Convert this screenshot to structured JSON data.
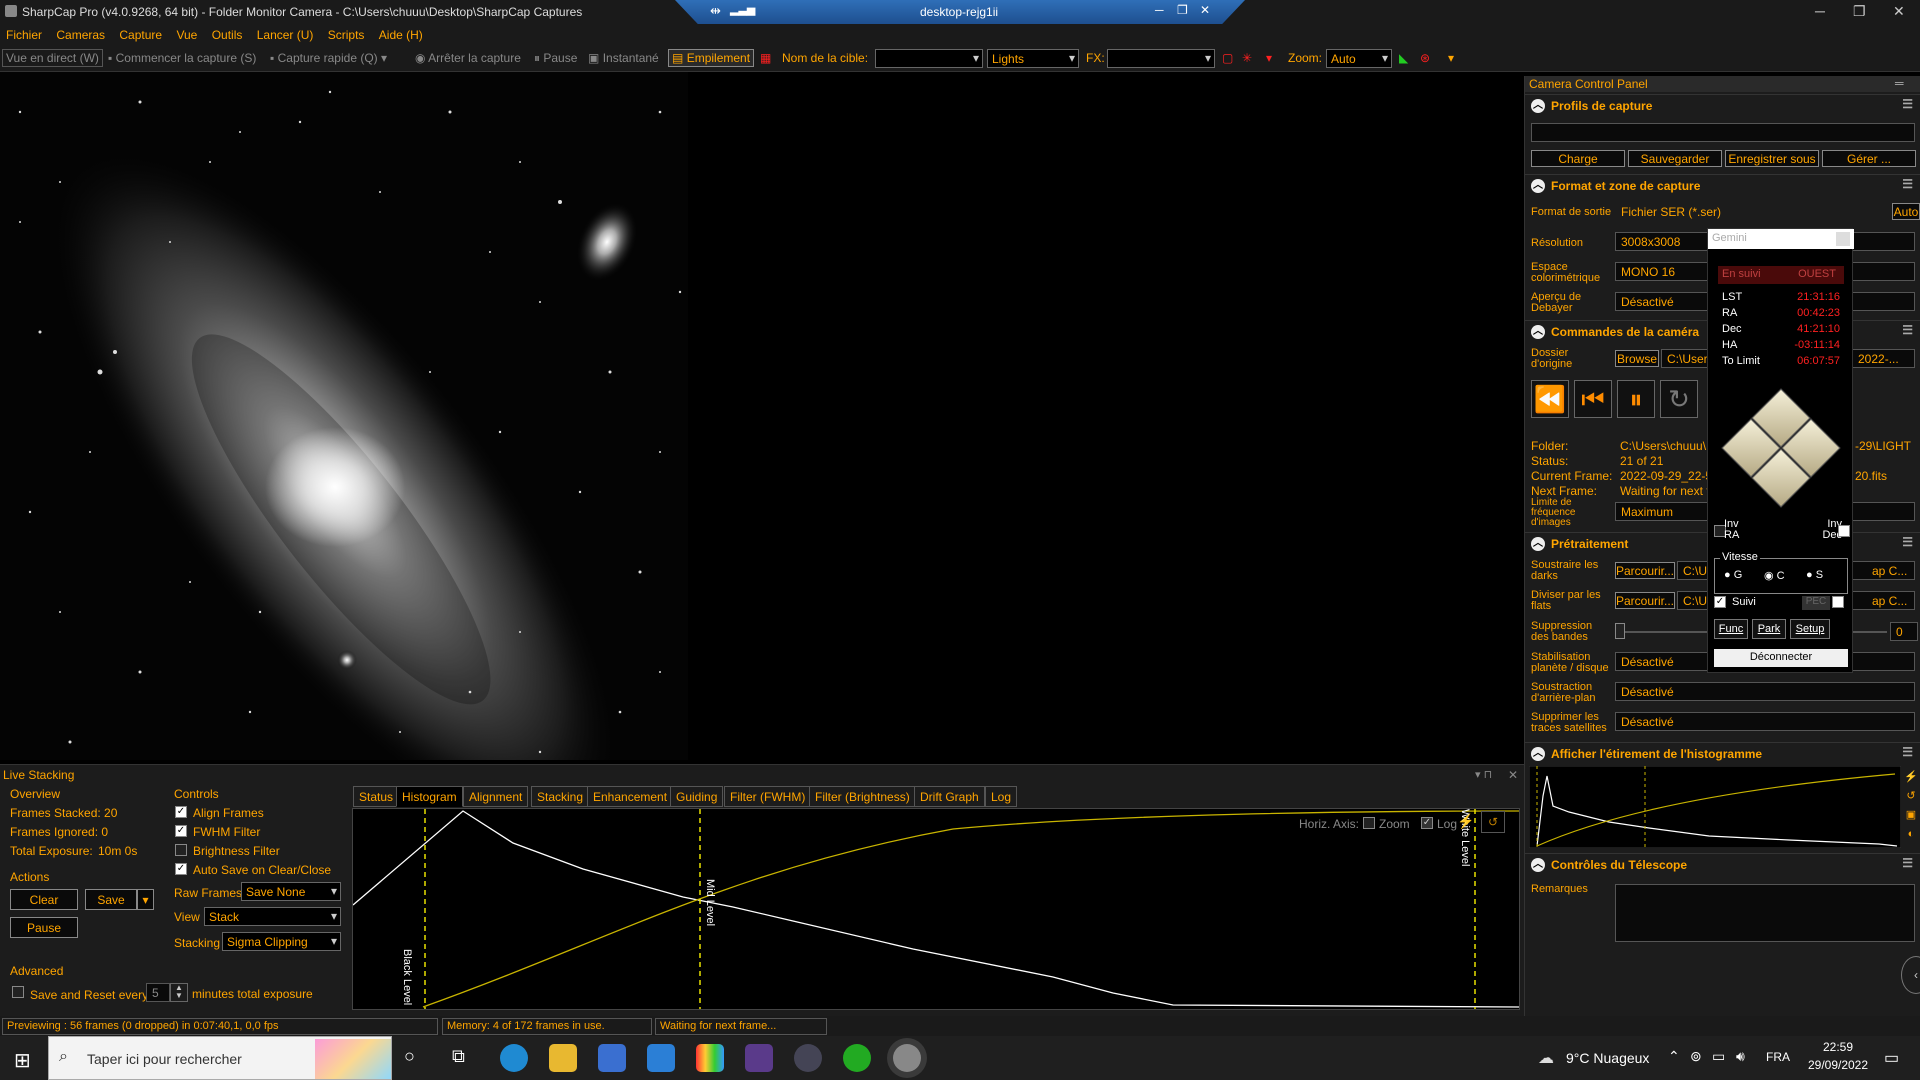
{
  "title_bar": {
    "title": "SharpCap Pro (v4.0.9268, 64 bit) - Folder Monitor Camera - C:\\Users\\chuuu\\Desktop\\SharpCap Captures",
    "remote": "desktop-rejg1ii"
  },
  "menu": [
    "Fichier",
    "Cameras",
    "Capture",
    "Vue",
    "Outils",
    "Lancer (U)",
    "Scripts",
    "Aide (H)"
  ],
  "toolbar": {
    "live_view": "Vue en direct (W)",
    "start_capture": "Commencer la capture (S)",
    "quick_capture": "Capture rapide (Q)",
    "stop_capture": "Arrêter la capture",
    "pause": "Pause",
    "snapshot": "Instantané",
    "stacking": "Empilement",
    "target_label": "Nom de la cible:",
    "target_value": "",
    "frame_type": "Lights",
    "fx_label": "FX:",
    "fx_value": "",
    "zoom_label": "Zoom:",
    "zoom_value": "Auto"
  },
  "camera_panel": {
    "title": "Camera Control Panel",
    "profiles": {
      "title": "Profils de capture",
      "value": "",
      "buttons": [
        "Charge",
        "Sauvegarder",
        "Enregistrer sous",
        "Gérer ..."
      ]
    },
    "format": {
      "title": "Format et zone de capture",
      "output_label": "Format de sortie",
      "output_value": "Fichier SER (*.ser)",
      "auto": "Auto",
      "res_label": "Résolution",
      "res_value": "3008x3008",
      "color_label": "Espace colorimétrique",
      "color_value": "MONO 16",
      "debayer_label": "Aperçu de Debayer",
      "debayer_value": "Désactivé"
    },
    "commands": {
      "title": "Commandes de la caméra",
      "origin_label": "Dossier d'origine",
      "browse": "Browse",
      "origin_value": "C:\\Users",
      "origin_tail": "2022-...",
      "folder_label": "Folder:",
      "folder_value": "C:\\Users\\chuuu\\",
      "folder_tail": "-29\\LIGHT",
      "status_label": "Status:",
      "status_value": "21 of 21",
      "current_label": "Current Frame:",
      "current_value": "2022-09-29_22-5",
      "current_tail": "20.fits",
      "next_label": "Next Frame:",
      "next_value": "Waiting for next f",
      "limit_label": "Limite de fréquence d'images",
      "limit_value": "Maximum"
    },
    "preprocessing": {
      "title": "Prétraitement",
      "darks_label": "Soustraire les darks",
      "darks_btn": "Parcourir...",
      "darks_value": "C:\\U",
      "darks_tail": "ap C...",
      "flats_label": "Diviser par les flats",
      "flats_btn": "Parcourir...",
      "flats_value": "C:\\U",
      "flats_tail": "ap C...",
      "banding_label": "Suppression des bandes",
      "banding_value": "0",
      "stab_label": "Stabilisation planète / disque",
      "stab_value": "Désactivé",
      "bg_label": "Soustraction d'arrière-plan",
      "bg_value": "Désactivé",
      "sat_label": "Supprimer les traces satellites",
      "sat_value": "Désactivé"
    },
    "histogram_title": "Afficher l'étirement de l'histogramme",
    "telescope": {
      "title": "Contrôles du Télescope",
      "remarks": "Remarques"
    }
  },
  "gemini": {
    "title": "Gemini",
    "tracking": "En suivi",
    "side": "OUEST",
    "rows": [
      {
        "k": "LST",
        "v": "21:31:16"
      },
      {
        "k": "RA",
        "v": "00:42:23"
      },
      {
        "k": "Dec",
        "v": "41:21:10"
      },
      {
        "k": "HA",
        "v": "-03:11:14"
      },
      {
        "k": "To Limit",
        "v": "06:07:57"
      }
    ],
    "inv_ra": "Inv RA",
    "inv_dec": "Inv Dec",
    "speed_label": "Vitesse",
    "speeds": [
      "G",
      "C",
      "S"
    ],
    "track": "Suivi",
    "pec": "PEC",
    "func": "Func",
    "park": "Park",
    "setup": "Setup",
    "disconnect": "Déconnecter"
  },
  "live_stacking": {
    "title": "Live Stacking",
    "overview": "Overview",
    "frames_stacked": "Frames Stacked: 20",
    "frames_ignored": "Frames Ignored: 0",
    "total_exposure_label": "Total Exposure:",
    "total_exposure_value": "10m 0s",
    "actions": "Actions",
    "clear": "Clear",
    "save": "Save",
    "pause": "Pause",
    "advanced": "Advanced",
    "save_reset": "Save and Reset every",
    "save_reset_value": "5",
    "save_reset_tail": "minutes total exposure",
    "controls": "Controls",
    "align": "Align Frames",
    "fwhm": "FWHM Filter",
    "brightness": "Brightness Filter",
    "autosave": "Auto Save on Clear/Close",
    "raw_label": "Raw Frames",
    "raw_value": "Save None",
    "view_label": "View",
    "view_value": "Stack",
    "stacking_label": "Stacking",
    "stacking_value": "Sigma Clipping",
    "tabs": [
      "Status",
      "Histogram",
      "Alignment",
      "Stacking",
      "Enhancement",
      "Guiding",
      "Filter (FWHM)",
      "Filter (Brightness)",
      "Drift Graph",
      "Log"
    ],
    "horiz_axis": "Horiz. Axis:",
    "zoom": "Zoom",
    "log": "Log",
    "black_level": "Black Level",
    "mid_level": "Mid Level",
    "white_level": "White Level"
  },
  "status": {
    "preview": "Previewing : 56 frames (0 dropped) in 0:07:40,1, 0,0 fps",
    "memory": "Memory: 4 of 172 frames in use.",
    "waiting": "Waiting for next frame..."
  },
  "taskbar": {
    "search": "Taper ici pour rechercher",
    "weather": "9°C  Nuageux",
    "lang": "FRA",
    "time": "22:59",
    "date": "29/09/2022"
  },
  "colors": {
    "accent": "#ffa500",
    "histogram_line": "#ffffff",
    "curve": "#c8b400",
    "marker": "#e8e000",
    "alert": "#ff2020"
  }
}
